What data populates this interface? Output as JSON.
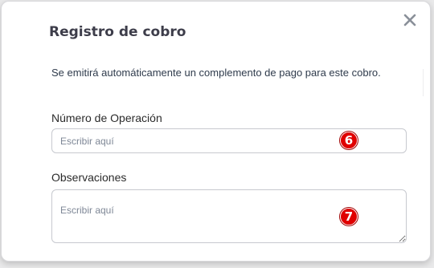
{
  "dialog": {
    "title": "Registro de cobro",
    "close_icon": "close-icon",
    "info_text": "Se emitirá automáticamente un complemento de pago para este cobro.",
    "fields": [
      {
        "label": "Número de Operación",
        "placeholder": "Escribir aquí",
        "value": "",
        "marker": "6"
      },
      {
        "label": "Observaciones",
        "placeholder": "Escribir aquí",
        "value": "",
        "marker": "7"
      }
    ]
  },
  "colors": {
    "title": "#3d3d4a",
    "marker_badge": "#e00000",
    "input_border": "#c7c9cf",
    "close_icon": "#8a9099"
  }
}
